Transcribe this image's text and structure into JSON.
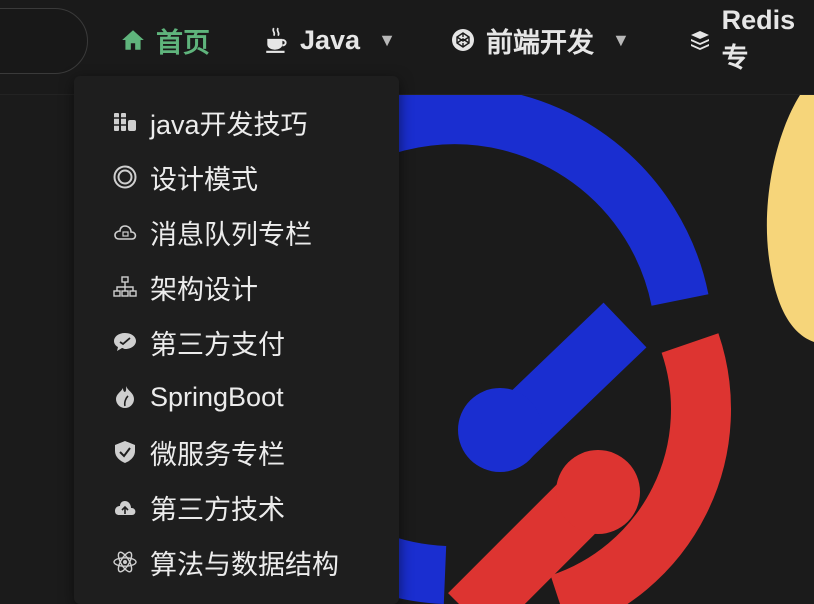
{
  "nav": {
    "home": {
      "label": "首页",
      "icon": "home-icon"
    },
    "java": {
      "label": "Java",
      "icon": "coffee-icon"
    },
    "frontend": {
      "label": "前端开发",
      "icon": "codepen-icon"
    },
    "redis": {
      "label": "Redis专",
      "icon": "layers-icon"
    }
  },
  "dropdown": {
    "items": [
      {
        "label": "java开发技巧",
        "icon": "books-icon"
      },
      {
        "label": "设计模式",
        "icon": "circle-ring-icon"
      },
      {
        "label": "消息队列专栏",
        "icon": "cloud-icon"
      },
      {
        "label": "架构设计",
        "icon": "sitemap-icon"
      },
      {
        "label": "第三方支付",
        "icon": "wechat-icon"
      },
      {
        "label": "SpringBoot",
        "icon": "leaf-icon"
      },
      {
        "label": "微服务专栏",
        "icon": "shield-icon"
      },
      {
        "label": "第三方技术",
        "icon": "cloud-upload-icon"
      },
      {
        "label": "算法与数据结构",
        "icon": "atom-icon"
      }
    ]
  },
  "colors": {
    "accent_green": "#5fb47c",
    "logo_blue": "#1a2ed0",
    "logo_red": "#dd3431",
    "logo_yellow": "#f6d57a"
  }
}
